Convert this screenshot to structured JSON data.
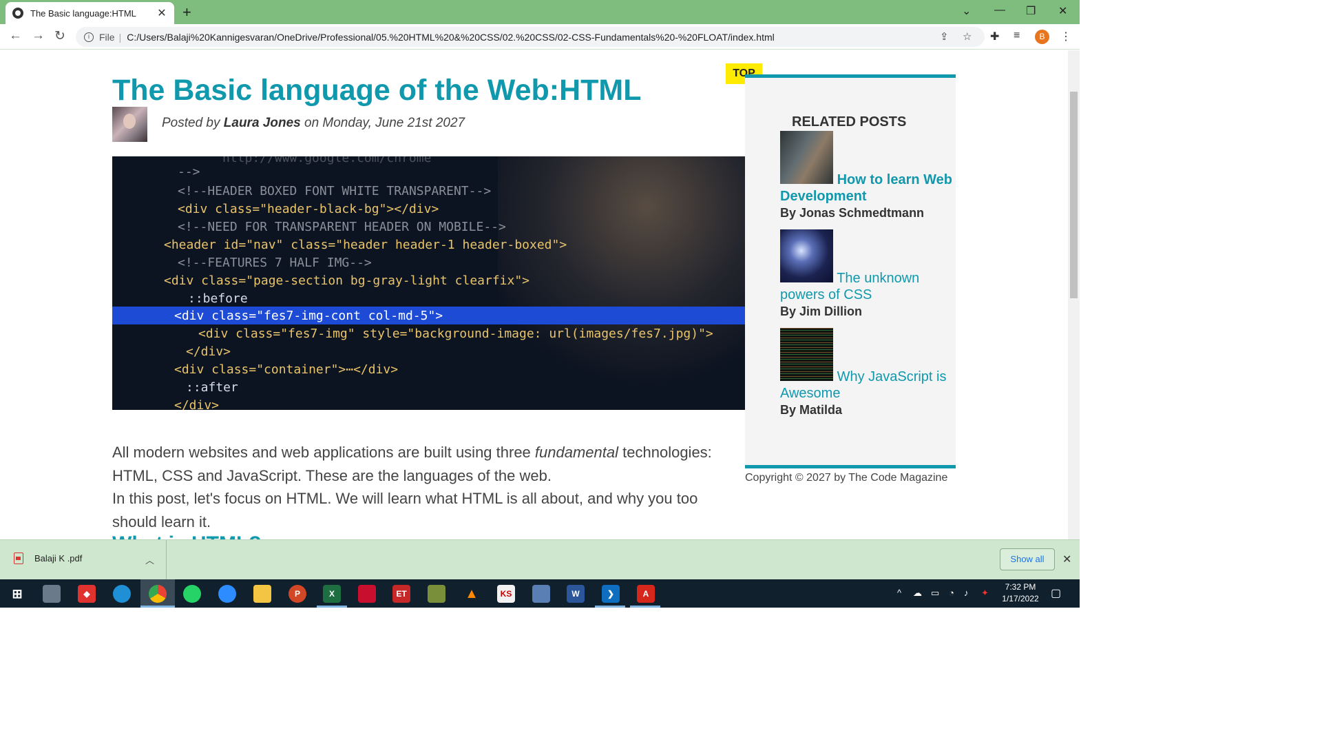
{
  "browser": {
    "tab_title": "The Basic language:HTML",
    "tab_close": "✕",
    "new_tab": "+",
    "address_info": "i",
    "address_file_label": "File",
    "address_sep": "|",
    "url": "C:/Users/Balaji%20Kannigesvaran/OneDrive/Professional/05.%20HTML%20&%20CSS/02.%20CSS/02-CSS-Fundamentals%20-%20FLOAT/index.html",
    "profile_initial": "B"
  },
  "article": {
    "title": "The Basic language of the Web:HTML",
    "byline_prefix": "Posted by",
    "author": "Laura Jones",
    "byline_suffix": "on Monday, June 21st 2027",
    "para1_a": "All modern websites and web applications are built using three",
    "para1_em": "fundamental",
    "para1_b": "technologies: HTML, CSS and JavaScript. These are the languages of the web.",
    "para2": "In this post, let's focus on HTML. We will learn what HTML is all about, and why you too should learn it.",
    "next_heading": "What is HTML?"
  },
  "code_lines": [
    "http://www.google.com/chrome",
    "-->",
    "<!--HEADER BOXED FONT WHITE TRANSPARENT-->",
    "<div class=\"header-black-bg\"></div>",
    "<!--NEED FOR TRANSPARENT HEADER ON MOBILE-->",
    "<header id=\"nav\" class=\"header header-1 header-boxed\">",
    "<!--FEATURES 7 HALF IMG-->",
    "<div class=\"page-section bg-gray-light clearfix\">",
    "::before",
    "<div class=\"fes7-img-cont col-md-5\">",
    "<div class=\"fes7-img\" style=\"background-image: url(images/fes7.jpg)\">",
    "</div>",
    "<div class=\"container\">⋯</div>",
    "::after",
    "</div>"
  ],
  "aside": {
    "top_label": "TOP",
    "heading": "RELATED POSTS",
    "posts": [
      {
        "title": "How to learn Web Development",
        "author": "By Jonas Schmedtmann"
      },
      {
        "title": "The unknown powers of CSS",
        "author": "By Jim Dillion"
      },
      {
        "title": "Why JavaScript is Awesome",
        "author": "By Matilda"
      }
    ],
    "copyright": "Copyright © 2027 by The Code Magazine"
  },
  "download_bar": {
    "file_name": "Balaji K .pdf",
    "show_all": "Show all"
  },
  "taskbar": {
    "time": "7:32 PM",
    "date": "1/17/2022"
  },
  "colors": {
    "accent": "#1098ad",
    "tab_strip": "#7ebd7e",
    "top_tag": "#ffeb00"
  }
}
